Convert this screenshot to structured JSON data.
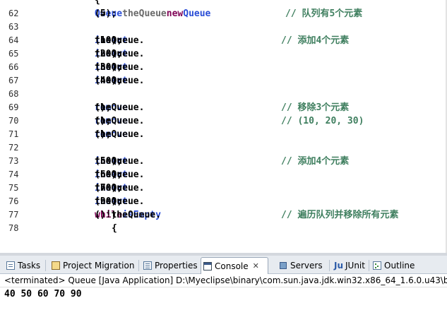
{
  "editor": {
    "lines": [
      {
        "num": "62",
        "indent": "        ",
        "tokens": [
          {
            "t": " ",
            "c": "tx"
          },
          {
            "t": "Queue",
            "c": "ty"
          },
          {
            "t": " ",
            "c": "tx"
          },
          {
            "t": "theQueue",
            "c": "vr"
          },
          {
            "t": " = ",
            "c": "tx"
          },
          {
            "t": "new",
            "c": "kw"
          },
          {
            "t": " ",
            "c": "tx"
          },
          {
            "t": "Queue",
            "c": "ty"
          },
          {
            "t": "(5);",
            "c": "tx"
          }
        ],
        "comment": "// 队列有5个元素"
      },
      {
        "num": "63",
        "indent": "",
        "tokens": [],
        "comment": ""
      },
      {
        "num": "64",
        "indent": "        ",
        "tokens": [
          {
            "t": "theQueue.",
            "c": "tx"
          },
          {
            "t": "insert",
            "c": "m"
          },
          {
            "t": "(10);",
            "c": "tx"
          }
        ],
        "comment": "// 添加4个元素"
      },
      {
        "num": "65",
        "indent": "        ",
        "tokens": [
          {
            "t": "theQueue.",
            "c": "tx"
          },
          {
            "t": "insert",
            "c": "m"
          },
          {
            "t": "(20);",
            "c": "tx"
          }
        ],
        "comment": ""
      },
      {
        "num": "66",
        "indent": "        ",
        "tokens": [
          {
            "t": "theQueue.",
            "c": "tx"
          },
          {
            "t": "insert",
            "c": "m"
          },
          {
            "t": "(30);",
            "c": "tx"
          }
        ],
        "comment": ""
      },
      {
        "num": "67",
        "indent": "        ",
        "tokens": [
          {
            "t": "theQueue.",
            "c": "tx"
          },
          {
            "t": "insert",
            "c": "m"
          },
          {
            "t": "(40);",
            "c": "tx"
          }
        ],
        "comment": ""
      },
      {
        "num": "68",
        "indent": "",
        "tokens": [],
        "comment": ""
      },
      {
        "num": "69",
        "indent": "        ",
        "tokens": [
          {
            "t": "theQueue.",
            "c": "tx"
          },
          {
            "t": "remove",
            "c": "m"
          },
          {
            "t": "();",
            "c": "tx"
          }
        ],
        "comment": "// 移除3个元素"
      },
      {
        "num": "70",
        "indent": "        ",
        "tokens": [
          {
            "t": "theQueue.",
            "c": "tx"
          },
          {
            "t": "remove",
            "c": "m"
          },
          {
            "t": "();",
            "c": "tx"
          }
        ],
        "comment": "// (10, 20, 30)"
      },
      {
        "num": "71",
        "indent": "        ",
        "tokens": [
          {
            "t": "theQueue.",
            "c": "tx"
          },
          {
            "t": "remove",
            "c": "m"
          },
          {
            "t": "();",
            "c": "tx"
          }
        ],
        "comment": ""
      },
      {
        "num": "72",
        "indent": "",
        "tokens": [],
        "comment": ""
      },
      {
        "num": "73",
        "indent": "        ",
        "tokens": [
          {
            "t": "theQueue.",
            "c": "tx"
          },
          {
            "t": "insert",
            "c": "m"
          },
          {
            "t": "(50);",
            "c": "tx"
          }
        ],
        "comment": "// 添加4个元素"
      },
      {
        "num": "74",
        "indent": "        ",
        "tokens": [
          {
            "t": "theQueue.",
            "c": "tx"
          },
          {
            "t": "insert",
            "c": "m"
          },
          {
            "t": "(60);",
            "c": "tx"
          }
        ],
        "comment": ""
      },
      {
        "num": "75",
        "indent": "        ",
        "tokens": [
          {
            "t": "theQueue.",
            "c": "tx"
          },
          {
            "t": "insert",
            "c": "m"
          },
          {
            "t": "(70);",
            "c": "tx"
          }
        ],
        "comment": ""
      },
      {
        "num": "76",
        "indent": "        ",
        "tokens": [
          {
            "t": "theQueue.",
            "c": "tx"
          },
          {
            "t": "insert",
            "c": "m"
          },
          {
            "t": "(90);",
            "c": "tx"
          }
        ],
        "comment": ""
      },
      {
        "num": "77",
        "indent": "        ",
        "tokens": [
          {
            "t": "while",
            "c": "kw"
          },
          {
            "t": "( !theQueue.",
            "c": "tx"
          },
          {
            "t": "isEmpty",
            "c": "m"
          },
          {
            "t": "() )",
            "c": "tx"
          }
        ],
        "comment": "// 遍历队列并移除所有元素"
      },
      {
        "num": "78",
        "indent": "          ",
        "tokens": [
          {
            "t": "{",
            "c": "tx"
          }
        ],
        "comment": ""
      }
    ]
  },
  "panel": {
    "tabs": [
      {
        "id": "tasks",
        "label": "Tasks",
        "icon": "tasks-icon",
        "active": false
      },
      {
        "id": "project-migration",
        "label": "Project Migration",
        "icon": "project-migration-icon",
        "active": false
      },
      {
        "id": "properties",
        "label": "Properties",
        "icon": "properties-icon",
        "active": false
      },
      {
        "id": "console",
        "label": "Console",
        "icon": "console-icon",
        "active": true,
        "close": "✕"
      },
      {
        "id": "servers",
        "label": "Servers",
        "icon": "servers-icon",
        "active": false
      },
      {
        "id": "junit",
        "label": "JUnit",
        "icon": "junit-icon",
        "active": false
      },
      {
        "id": "outline",
        "label": "Outline",
        "icon": "outline-icon",
        "active": false
      }
    ],
    "status": "<terminated> Queue [Java Application] D:\\Myeclipse\\binary\\com.sun.java.jdk.win32.x86_64_1.6.0.u43\\bin\\jav",
    "output": "40 50 60 70 90"
  },
  "colors": {
    "keyword": "#7f0055",
    "method": "#2a4dd6",
    "comment": "#3f7f5f",
    "panel_bg": "#e7ebf0"
  }
}
